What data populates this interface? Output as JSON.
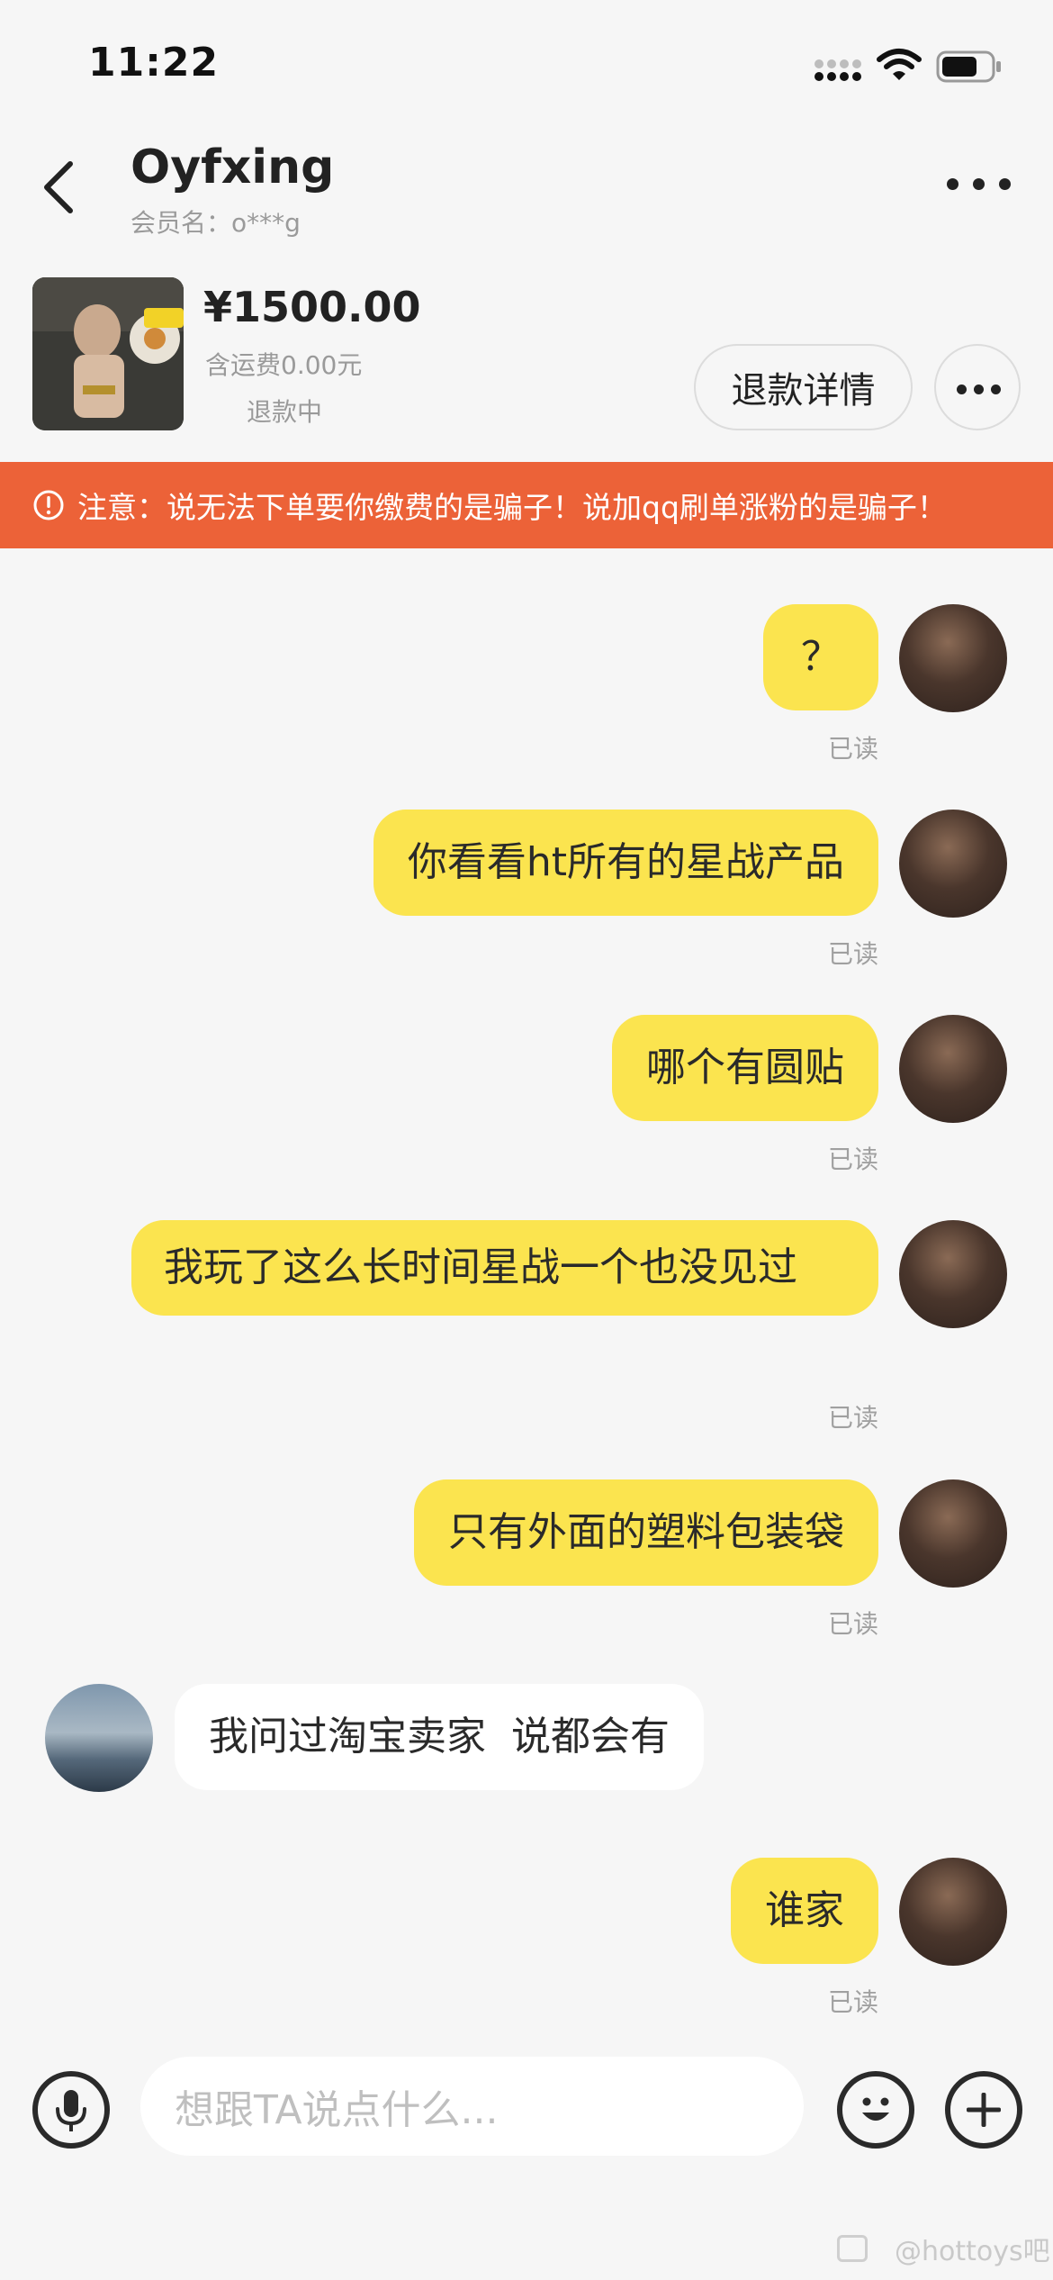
{
  "status_bar": {
    "time": "11:22"
  },
  "header": {
    "contact_name": "Oyfxing",
    "member_name": "会员名：o***g"
  },
  "product": {
    "price": "¥1500.00",
    "shipping": "含运费0.00元",
    "status": "退款中",
    "refund_button_label": "退款详情"
  },
  "warning": {
    "text": "注意：说无法下单要你缴费的是骗子！说加qq刷单涨粉的是骗子！"
  },
  "messages": [
    {
      "sender": "me",
      "text": "？",
      "read": "已读"
    },
    {
      "sender": "me",
      "text": "你看看ht所有的星战产品",
      "read": "已读"
    },
    {
      "sender": "me",
      "text": "哪个有圆贴",
      "read": "已读"
    },
    {
      "sender": "me",
      "text": "我玩了这么长时间星战一个也没见过",
      "read": "已读"
    },
    {
      "sender": "me",
      "text": "只有外面的塑料包装袋",
      "read": "已读"
    },
    {
      "sender": "other",
      "text": "我问过淘宝卖家  说都会有"
    },
    {
      "sender": "me",
      "text": "谁家",
      "read": "已读"
    }
  ],
  "input": {
    "placeholder": "想跟TA说点什么..."
  },
  "watermark": {
    "text": "@hottoys吧"
  },
  "colors": {
    "my_bubble": "#fbe44f",
    "other_bubble": "#ffffff",
    "warning_banner": "#ec6238",
    "background": "#f6f6f6"
  },
  "icons": [
    "back-icon",
    "more-icon",
    "warning-icon",
    "microphone-icon",
    "emoji-icon",
    "plus-icon",
    "wifi-icon",
    "battery-icon"
  ]
}
